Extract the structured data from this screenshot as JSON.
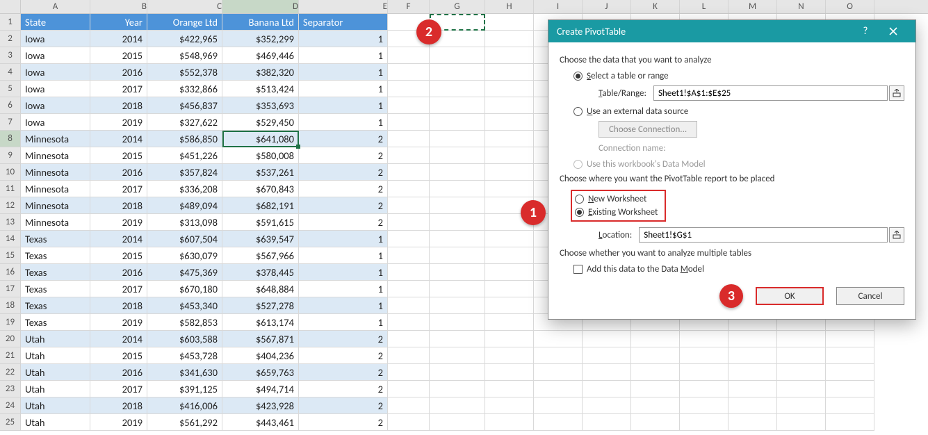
{
  "chart_data": {
    "type": "table",
    "columns": [
      "State",
      "Year",
      "Orange Ltd",
      "Banana Ltd",
      "Separator"
    ],
    "rows": [
      [
        "Iowa",
        2014,
        422965,
        352299,
        1
      ],
      [
        "Iowa",
        2015,
        548969,
        469446,
        1
      ],
      [
        "Iowa",
        2016,
        552378,
        382320,
        1
      ],
      [
        "Iowa",
        2017,
        332866,
        513424,
        1
      ],
      [
        "Iowa",
        2018,
        456837,
        353693,
        1
      ],
      [
        "Iowa",
        2019,
        327622,
        529450,
        1
      ],
      [
        "Minnesota",
        2014,
        586850,
        641080,
        2
      ],
      [
        "Minnesota",
        2015,
        451226,
        580008,
        2
      ],
      [
        "Minnesota",
        2016,
        357824,
        537261,
        2
      ],
      [
        "Minnesota",
        2017,
        336208,
        670843,
        2
      ],
      [
        "Minnesota",
        2018,
        489094,
        682191,
        2
      ],
      [
        "Minnesota",
        2019,
        313098,
        591615,
        2
      ],
      [
        "Texas",
        2014,
        607504,
        639547,
        1
      ],
      [
        "Texas",
        2015,
        630079,
        567966,
        1
      ],
      [
        "Texas",
        2016,
        475369,
        378445,
        1
      ],
      [
        "Texas",
        2017,
        670180,
        648884,
        1
      ],
      [
        "Texas",
        2018,
        453340,
        527278,
        1
      ],
      [
        "Texas",
        2019,
        582853,
        613174,
        1
      ],
      [
        "Utah",
        2014,
        603588,
        567871,
        2
      ],
      [
        "Utah",
        2015,
        453728,
        404236,
        2
      ],
      [
        "Utah",
        2016,
        341630,
        659763,
        2
      ],
      [
        "Utah",
        2017,
        391125,
        494714,
        2
      ],
      [
        "Utah",
        2018,
        416006,
        423928,
        2
      ],
      [
        "Utah",
        2019,
        561292,
        443461,
        2
      ]
    ]
  },
  "columns": [
    "A",
    "B",
    "C",
    "D",
    "E",
    "F",
    "G",
    "H",
    "I",
    "J",
    "K",
    "L",
    "M",
    "N",
    "O"
  ],
  "headers": {
    "A": "State",
    "B": "Year",
    "C": "Orange Ltd",
    "D": "Banana Ltd",
    "E": "Separator"
  },
  "rows": [
    {
      "n": 2,
      "band": 1,
      "A": "Iowa",
      "B": "2014",
      "C": "$422,965",
      "D": "$352,299",
      "E": "1"
    },
    {
      "n": 3,
      "band": 0,
      "A": "Iowa",
      "B": "2015",
      "C": "$548,969",
      "D": "$469,446",
      "E": "1"
    },
    {
      "n": 4,
      "band": 1,
      "A": "Iowa",
      "B": "2016",
      "C": "$552,378",
      "D": "$382,320",
      "E": "1"
    },
    {
      "n": 5,
      "band": 0,
      "A": "Iowa",
      "B": "2017",
      "C": "$332,866",
      "D": "$513,424",
      "E": "1"
    },
    {
      "n": 6,
      "band": 1,
      "A": "Iowa",
      "B": "2018",
      "C": "$456,837",
      "D": "$353,693",
      "E": "1"
    },
    {
      "n": 7,
      "band": 0,
      "A": "Iowa",
      "B": "2019",
      "C": "$327,622",
      "D": "$529,450",
      "E": "1"
    },
    {
      "n": 8,
      "band": 1,
      "A": "Minnesota",
      "B": "2014",
      "C": "$586,850",
      "D": "$641,080",
      "E": "2",
      "sel": true
    },
    {
      "n": 9,
      "band": 0,
      "A": "Minnesota",
      "B": "2015",
      "C": "$451,226",
      "D": "$580,008",
      "E": "2"
    },
    {
      "n": 10,
      "band": 1,
      "A": "Minnesota",
      "B": "2016",
      "C": "$357,824",
      "D": "$537,261",
      "E": "2"
    },
    {
      "n": 11,
      "band": 0,
      "A": "Minnesota",
      "B": "2017",
      "C": "$336,208",
      "D": "$670,843",
      "E": "2"
    },
    {
      "n": 12,
      "band": 1,
      "A": "Minnesota",
      "B": "2018",
      "C": "$489,094",
      "D": "$682,191",
      "E": "2"
    },
    {
      "n": 13,
      "band": 0,
      "A": "Minnesota",
      "B": "2019",
      "C": "$313,098",
      "D": "$591,615",
      "E": "2"
    },
    {
      "n": 14,
      "band": 1,
      "A": "Texas",
      "B": "2014",
      "C": "$607,504",
      "D": "$639,547",
      "E": "1"
    },
    {
      "n": 15,
      "band": 0,
      "A": "Texas",
      "B": "2015",
      "C": "$630,079",
      "D": "$567,966",
      "E": "1"
    },
    {
      "n": 16,
      "band": 1,
      "A": "Texas",
      "B": "2016",
      "C": "$475,369",
      "D": "$378,445",
      "E": "1"
    },
    {
      "n": 17,
      "band": 0,
      "A": "Texas",
      "B": "2017",
      "C": "$670,180",
      "D": "$648,884",
      "E": "1"
    },
    {
      "n": 18,
      "band": 1,
      "A": "Texas",
      "B": "2018",
      "C": "$453,340",
      "D": "$527,278",
      "E": "1"
    },
    {
      "n": 19,
      "band": 0,
      "A": "Texas",
      "B": "2019",
      "C": "$582,853",
      "D": "$613,174",
      "E": "1"
    },
    {
      "n": 20,
      "band": 1,
      "A": "Utah",
      "B": "2014",
      "C": "$603,588",
      "D": "$567,871",
      "E": "2"
    },
    {
      "n": 21,
      "band": 0,
      "A": "Utah",
      "B": "2015",
      "C": "$453,728",
      "D": "$404,236",
      "E": "2"
    },
    {
      "n": 22,
      "band": 1,
      "A": "Utah",
      "B": "2016",
      "C": "$341,630",
      "D": "$659,763",
      "E": "2"
    },
    {
      "n": 23,
      "band": 0,
      "A": "Utah",
      "B": "2017",
      "C": "$391,125",
      "D": "$494,714",
      "E": "2"
    },
    {
      "n": 24,
      "band": 1,
      "A": "Utah",
      "B": "2018",
      "C": "$416,006",
      "D": "$423,928",
      "E": "2"
    },
    {
      "n": 25,
      "band": 0,
      "A": "Utah",
      "B": "2019",
      "C": "$561,292",
      "D": "$443,461",
      "E": "2"
    }
  ],
  "dialog": {
    "title": "Create PivotTable",
    "section1": "Choose the data that you want to analyze",
    "opt_select": "Select a table or range",
    "table_range_label": "Table/Range:",
    "table_range_value": "Sheet1!$A$1:$E$25",
    "opt_external": "Use an external data source",
    "choose_conn": "Choose Connection...",
    "conn_name": "Connection name:",
    "opt_datamodel_src": "Use this workbook's Data Model",
    "section2": "Choose where you want the PivotTable report to be placed",
    "opt_new": "New Worksheet",
    "opt_existing": "Existing Worksheet",
    "location_label": "Location:",
    "location_value": "Sheet1!$G$1",
    "section3": "Choose whether you want to analyze multiple tables",
    "add_datamodel": "Add this data to the Data Model",
    "ok": "OK",
    "cancel": "Cancel"
  },
  "callouts": {
    "c1": "1",
    "c2": "2",
    "c3": "3"
  }
}
